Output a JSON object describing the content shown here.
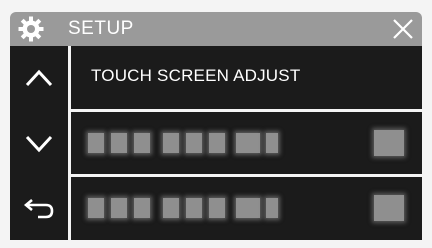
{
  "header": {
    "title": "SETUP",
    "settings_icon": "gear-icon",
    "close_icon": "close-icon"
  },
  "nav": {
    "up_icon": "chevron-up-icon",
    "down_icon": "chevron-down-icon",
    "back_icon": "return-arrow-icon"
  },
  "menu": {
    "items": [
      {
        "label": "TOUCH SCREEN ADJUST"
      }
    ]
  },
  "colors": {
    "titlebar": "#9a9a9a",
    "panel": "#1b1b1b",
    "text": "#ffffff",
    "blurred": "#8f8f8f"
  }
}
